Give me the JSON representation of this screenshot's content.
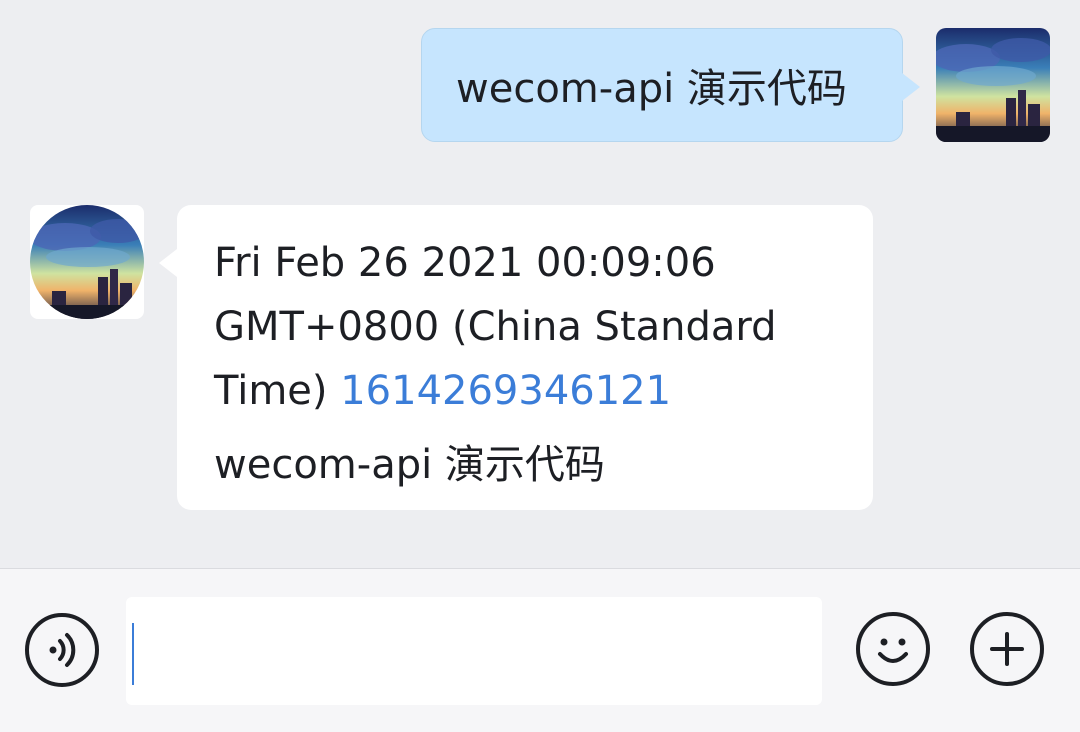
{
  "messages": {
    "outgoing": {
      "text": "wecom-api 演示代码"
    },
    "incoming": {
      "text_line": "Fri Feb 26 2021 00:09:06 GMT+0800 (China Standard Time)",
      "link": "1614269346121",
      "text_2": "wecom-api 演示代码"
    }
  },
  "input": {
    "value": "",
    "placeholder": ""
  },
  "icons": {
    "voice": "voice-icon",
    "emoji": "smiley-icon",
    "more": "plus-icon"
  },
  "colors": {
    "background": "#EDEEF1",
    "outgoing_bubble": "#C6E5FE",
    "incoming_bubble": "#FFFFFF",
    "link": "#3B7DD8",
    "text": "#1D1F24"
  }
}
